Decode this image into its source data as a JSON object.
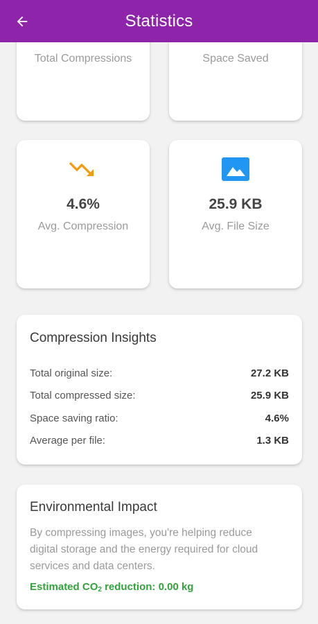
{
  "appbar": {
    "title": "Statistics",
    "back_icon": "arrow-left-icon",
    "color": "#8e24aa"
  },
  "stats": [
    {
      "label": "Total Compressions",
      "value": ""
    },
    {
      "label": "Space Saved",
      "value": ""
    },
    {
      "label": "Avg. Compression",
      "value": "4.6%",
      "icon": "trending-down-icon",
      "icon_color": "#f29a0b"
    },
    {
      "label": "Avg. File Size",
      "value": "25.9 KB",
      "icon": "image-icon",
      "icon_color": "#2196f3"
    }
  ],
  "insights": {
    "title": "Compression Insights",
    "rows": [
      {
        "label": "Total original size:",
        "value": "27.2 KB"
      },
      {
        "label": "Total compressed size:",
        "value": "25.9 KB"
      },
      {
        "label": "Space saving ratio:",
        "value": "4.6%"
      },
      {
        "label": "Average per file:",
        "value": "1.3 KB"
      }
    ]
  },
  "environment": {
    "title": "Environmental Impact",
    "description": "By compressing images, you're helping reduce digital storage and the energy required for cloud services and data centers.",
    "co2_prefix": "Estimated CO",
    "co2_subscript": "2",
    "co2_suffix": " reduction: 0.00 kg",
    "accent_color": "#33a23b"
  }
}
